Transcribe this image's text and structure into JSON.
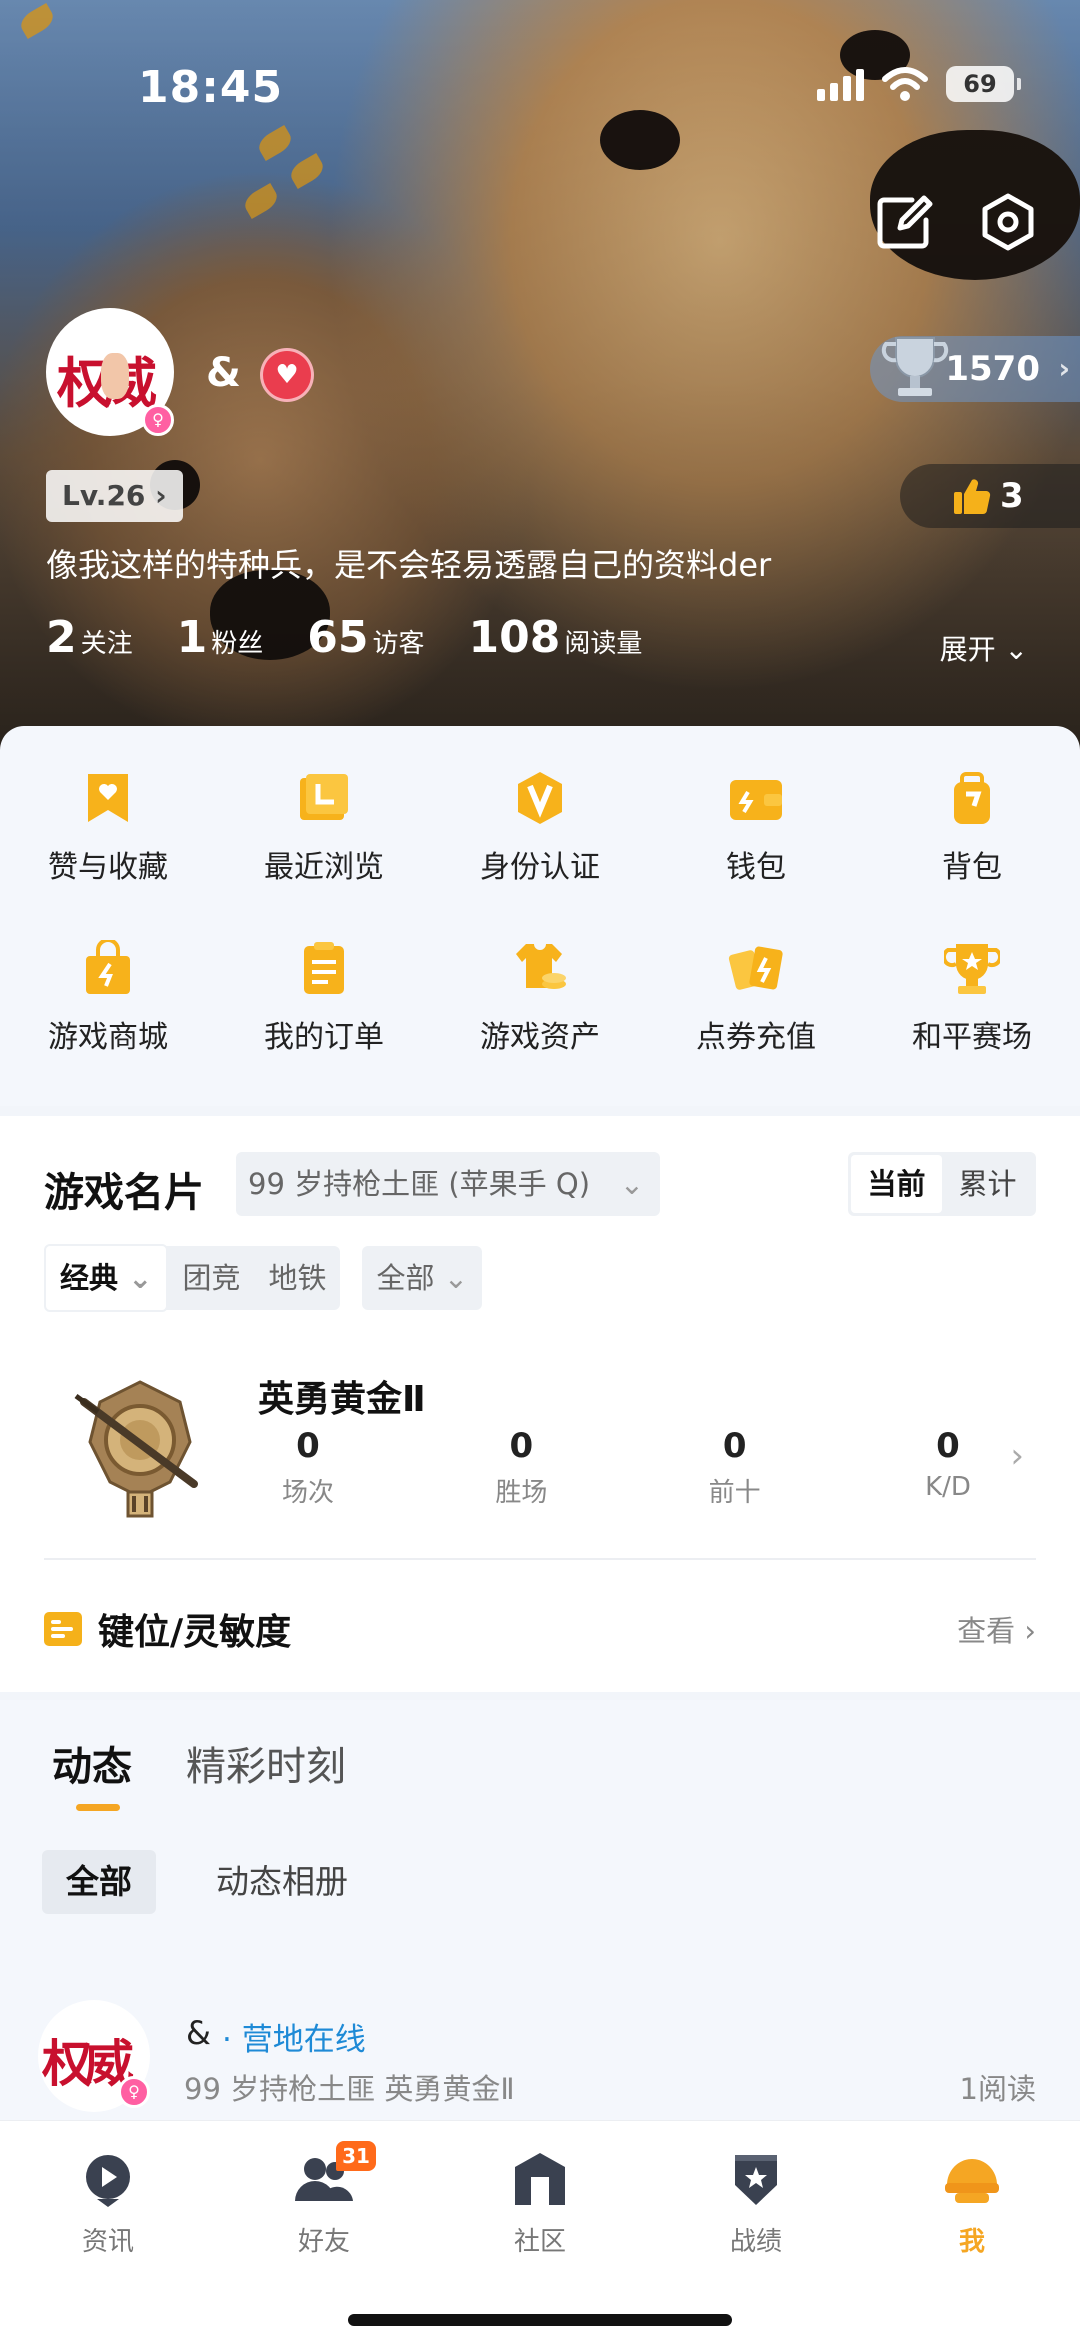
{
  "status_bar": {
    "time": "18:45",
    "battery": "69"
  },
  "profile": {
    "nickname": "&",
    "level": "Lv.26 ›",
    "bio": "像我这样的特种兵，是不会轻易透露自己的资料der",
    "trophy_score": "1570",
    "likes": "3",
    "expand_label": "展开",
    "stats": [
      {
        "num": "2",
        "label": "关注"
      },
      {
        "num": "1",
        "label": "粉丝"
      },
      {
        "num": "65",
        "label": "访客"
      },
      {
        "num": "108",
        "label": "阅读量"
      }
    ]
  },
  "menu": [
    {
      "label": "赞与收藏",
      "icon": "bookmark-heart-icon"
    },
    {
      "label": "最近浏览",
      "icon": "recent-browse-icon"
    },
    {
      "label": "身份认证",
      "icon": "verify-badge-icon"
    },
    {
      "label": "钱包",
      "icon": "wallet-icon"
    },
    {
      "label": "背包",
      "icon": "backpack-icon"
    },
    {
      "label": "游戏商城",
      "icon": "shopping-bag-icon"
    },
    {
      "label": "我的订单",
      "icon": "order-clipboard-icon"
    },
    {
      "label": "游戏资产",
      "icon": "tshirt-coins-icon"
    },
    {
      "label": "点券充值",
      "icon": "coupon-cards-icon"
    },
    {
      "label": "和平赛场",
      "icon": "trophy-star-icon"
    }
  ],
  "game_card": {
    "title": "游戏名片",
    "account": "99 岁持枪土匪 (苹果手 Q)",
    "seg_current": "当前",
    "seg_total": "累计",
    "mode_classic": "经典",
    "mode_team": "团竞",
    "mode_metro": "地铁",
    "mode_all": "全部",
    "rank_name": "英勇黄金Ⅱ",
    "rank_stats": [
      {
        "value": "0",
        "label": "场次"
      },
      {
        "value": "0",
        "label": "胜场"
      },
      {
        "value": "0",
        "label": "前十"
      },
      {
        "value": "0",
        "label": "K/D"
      }
    ],
    "keys_label": "键位/灵敏度",
    "keys_look": "查看"
  },
  "feed": {
    "tab_dynamic": "动态",
    "tab_highlights": "精彩时刻",
    "chip_all": "全部",
    "chip_album": "动态相册",
    "post": {
      "name": "&",
      "online": "· 营地在线",
      "meta": "99 岁持枪土匪    英勇黄金Ⅱ",
      "reads": "1阅读"
    }
  },
  "bottom_nav": {
    "items": [
      {
        "label": "资讯",
        "icon": "news-play-icon"
      },
      {
        "label": "好友",
        "icon": "friends-icon",
        "badge": "31"
      },
      {
        "label": "社区",
        "icon": "community-house-icon"
      },
      {
        "label": "战绩",
        "icon": "record-shield-icon"
      },
      {
        "label": "我",
        "icon": "helmet-me-icon"
      }
    ]
  },
  "colors": {
    "accent": "#f5a623",
    "online": "#1e8ad6",
    "heart": "#ea3d4e"
  }
}
